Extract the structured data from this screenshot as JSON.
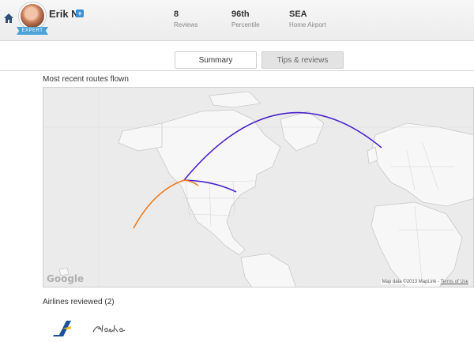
{
  "user": {
    "name": "Erik N",
    "badge": "EXPERT"
  },
  "stats": [
    {
      "value": "8",
      "label": "Reviews"
    },
    {
      "value": "96th",
      "label": "Percentile"
    },
    {
      "value": "SEA",
      "label": "Home Airport"
    }
  ],
  "tabs": [
    {
      "label": "Summary",
      "active": true
    },
    {
      "label": "Tips & reviews",
      "active": false
    }
  ],
  "map": {
    "title": "Most recent routes flown",
    "provider": "Google",
    "attribution": "Map data ©2013 MapLink",
    "terms": "Terms of Use",
    "route_colors": [
      "#4a22c9",
      "#f07a1a"
    ]
  },
  "airlines": {
    "title": "Airlines reviewed (2)",
    "items": [
      {
        "name": "Icelandair",
        "icon": "icelandair-logo",
        "color": "#1b4f9c"
      },
      {
        "name": "Alaska",
        "icon": "alaska-airlines-logo"
      }
    ]
  },
  "icons": {
    "home": "home-icon",
    "add": "add-friend-icon",
    "logo_accent": "#4aa2d9"
  }
}
